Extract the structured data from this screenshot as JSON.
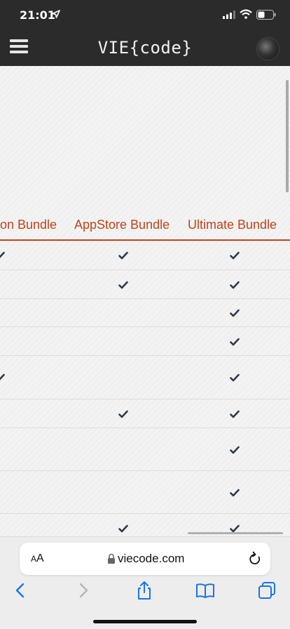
{
  "status_bar": {
    "time": "21:01"
  },
  "header": {
    "brand": "VIE{code}"
  },
  "table": {
    "columns": [
      {
        "label": "on Bundle"
      },
      {
        "label": "AppStore Bundle"
      },
      {
        "label": "Ultimate Bundle"
      }
    ],
    "rows": [
      {
        "checks": [
          true,
          true,
          true
        ]
      },
      {
        "checks": [
          false,
          true,
          true
        ]
      },
      {
        "checks": [
          false,
          false,
          true
        ]
      },
      {
        "checks": [
          false,
          false,
          true
        ]
      },
      {
        "checks": [
          true,
          false,
          true
        ]
      },
      {
        "checks": [
          false,
          true,
          true
        ]
      },
      {
        "checks": [
          false,
          false,
          true
        ]
      },
      {
        "checks": [
          false,
          false,
          true
        ]
      },
      {
        "checks": [
          false,
          true,
          true
        ]
      }
    ]
  },
  "browser": {
    "aa_small": "A",
    "aa_big": "A",
    "url": "viecode.com"
  },
  "colors": {
    "accent": "#c0441a",
    "header_bg": "#2b2b2b",
    "ios_blue": "#1a73e8"
  }
}
